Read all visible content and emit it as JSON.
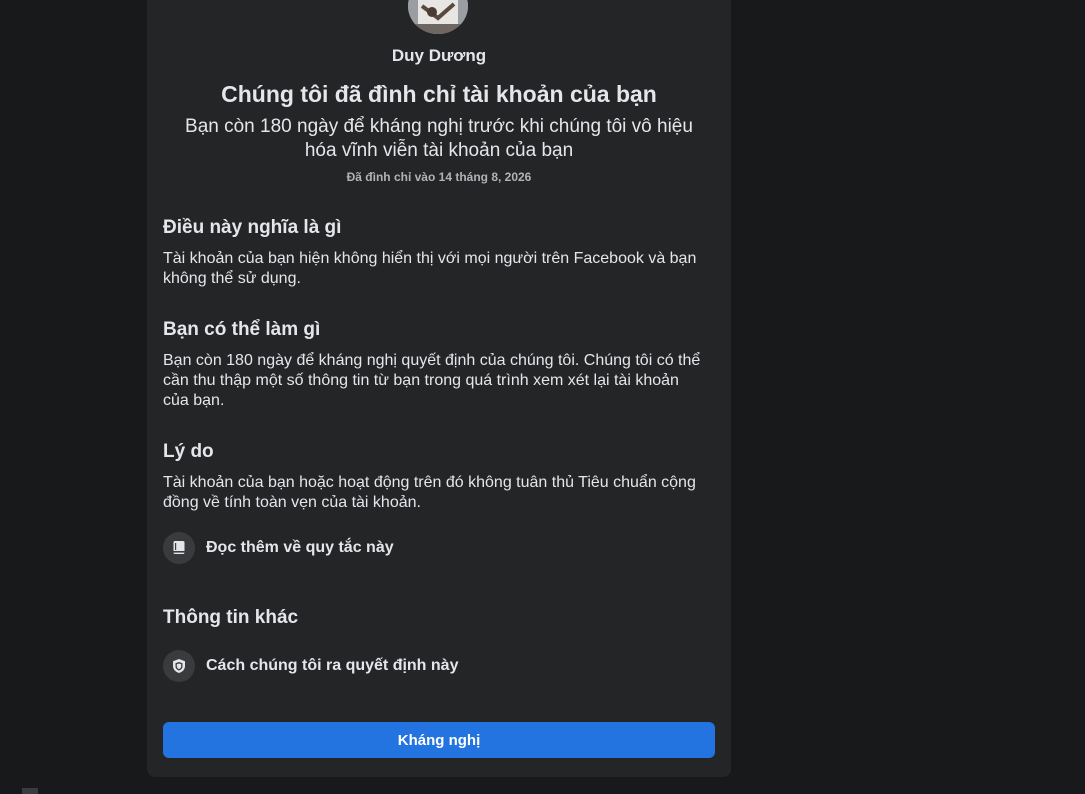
{
  "profile": {
    "name": "Duy Dương",
    "avatar_icon": "profile-photo-icon"
  },
  "notice": {
    "headline": "Chúng tôi đã đình chỉ tài khoản của bạn",
    "subline": "Bạn còn 180 ngày để kháng nghị trước khi chúng tôi vô hiệu hóa vĩnh viễn tài khoản của bạn",
    "date": "Đã đình chỉ vào 14 tháng 8, 2026"
  },
  "sections": {
    "meaning": {
      "title": "Điều này nghĩa là gì",
      "body": "Tài khoản của bạn hiện không hiển thị với mọi người trên Facebook và bạn không thể sử dụng."
    },
    "what_you_can_do": {
      "title": "Bạn có thể làm gì",
      "body": "Bạn còn 180 ngày để kháng nghị quyết định của chúng tôi. Chúng tôi có thể cần thu thập một số thông tin từ bạn trong quá trình xem xét lại tài khoản của bạn."
    },
    "reason": {
      "title": "Lý do",
      "body": "Tài khoản của bạn hoặc hoạt động trên đó không tuân thủ Tiêu chuẩn cộng đồng về tính toàn vẹn của tài khoản.",
      "link_label": "Đọc thêm về quy tắc này",
      "link_icon": "book-icon"
    },
    "other_info": {
      "title": "Thông tin khác",
      "link_label": "Cách chúng tôi ra quyết định này",
      "link_icon": "shield-icon"
    }
  },
  "actions": {
    "appeal_label": "Kháng nghị"
  },
  "colors": {
    "background": "#18191a",
    "card": "#242526",
    "primary_button": "#2374e1",
    "icon_circle": "#3a3b3c",
    "text_primary": "#e4e6eb",
    "text_secondary": "#b0b3b8"
  }
}
